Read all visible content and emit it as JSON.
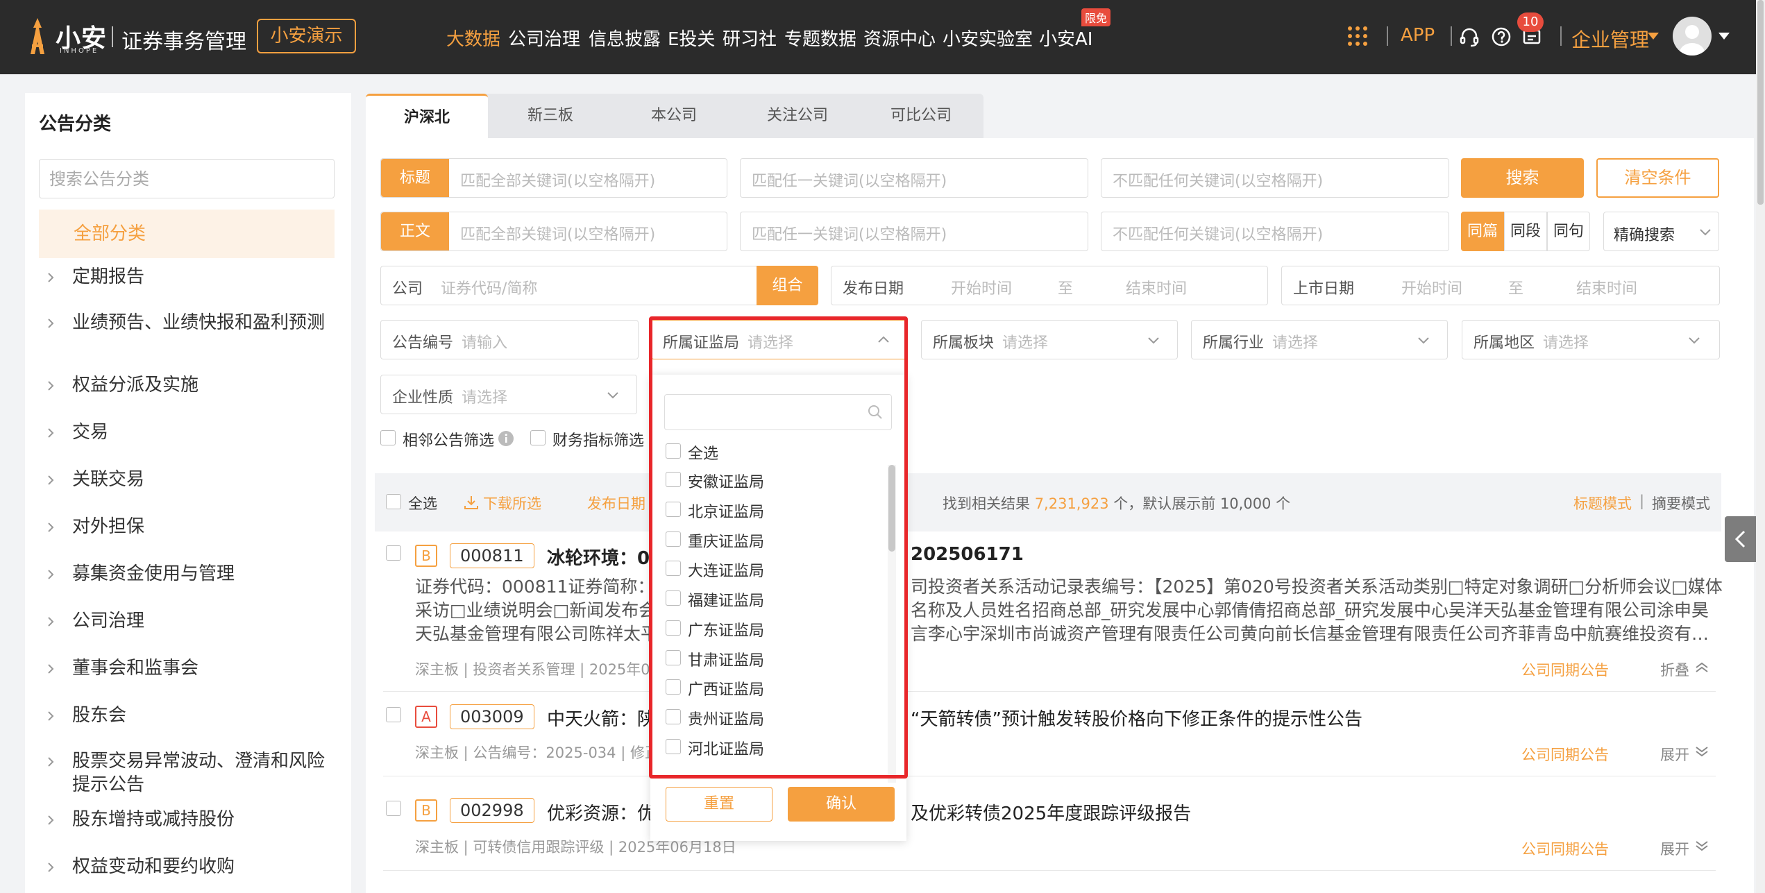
{
  "topbar": {
    "logo_text": "小安",
    "logo_sub": "INHOPE",
    "app_title": "证券事务管理",
    "demo_button": "小安演示",
    "nav": [
      "大数据",
      "公司治理",
      "信息披露",
      "E投关",
      "研习社",
      "专题数据",
      "资源中心",
      "小安实验室",
      "小安AI"
    ],
    "nav_active": "大数据",
    "limited_badge": "限免",
    "app_link": "APP",
    "message_count": "10",
    "enterprise_menu": "企业管理",
    "accent_color": "#f5a040"
  },
  "sidebar": {
    "title": "公告分类",
    "search_placeholder": "搜索公告分类",
    "all_label": "全部分类",
    "items": [
      "定期报告",
      "业绩预告、业绩快报和盈利预测",
      "权益分派及实施",
      "交易",
      "关联交易",
      "对外担保",
      "募集资金使用与管理",
      "公司治理",
      "董事会和监事会",
      "股东会",
      "股票交易异常波动、澄清和风险提示公告",
      "股东增持或减持股份",
      "权益变动和要约收购"
    ]
  },
  "tabs": [
    "沪深北",
    "新三板",
    "本公司",
    "关注公司",
    "可比公司"
  ],
  "filters": {
    "title_label": "标题",
    "body_label": "正文",
    "match_all_ph": "匹配全部关键词(以空格隔开)",
    "match_any_ph": "匹配任一关键词(以空格隔开)",
    "match_none_ph": "不匹配任何关键词(以空格隔开)",
    "search_button": "搜索",
    "clear_button": "清空条件",
    "scope_options": [
      "同篇",
      "同段",
      "同句"
    ],
    "scope_active": "同篇",
    "precision_select": "精确搜索",
    "company_label": "公司",
    "company_ph": "证券代码/简称",
    "combo_button": "组合",
    "publish_date_label": "发布日期",
    "listing_date_label": "上市日期",
    "start_ph": "开始时间",
    "to": "至",
    "end_ph": "结束时间",
    "notice_no_label": "公告编号",
    "notice_no_ph": "请输入",
    "regulator_label": "所属证监局",
    "select_ph": "请选择",
    "sector_label": "所属板块",
    "industry_label": "所属行业",
    "region_label": "所属地区",
    "nature_label": "企业性质",
    "adjacent_filter": "相邻公告筛选",
    "finance_filter": "财务指标筛选"
  },
  "results_bar": {
    "select_all": "全选",
    "download": "下载所选",
    "sort_publish": "发布日期",
    "found_prefix": "找到相关结果",
    "count": "7,231,923",
    "found_suffix": "个，默认展示前 10,000 个",
    "mode_title": "标题模式",
    "mode_sep": "|",
    "mode_summary": "摘要模式"
  },
  "results": [
    {
      "level": "B",
      "code": "000811",
      "title_left": "冰轮环境：00",
      "title_right": "司投资者关系活动记录表编号：【2025】第020号投资者关系活动类别□特定对象调研□分析师会议□媒体",
      "title_right_head": "202506171",
      "body_left_1": "证券代码：000811证券简称：冫",
      "body_right_1": "司投资者关系活动记录表编号：【2025】第020号投资者关系活动类别□特定对象调研□分析师会议□媒体",
      "body_left_2": "采访□业绩说明会□新闻发布会",
      "body_right_2": "名称及人员姓名招商总部_研究发展中心郭倩倩招商总部_研究发展中心吴洋天弘基金管理有限公司涂申昊",
      "body_left_3": "天弘基金管理有限公司陈祥太平",
      "body_right_3": "言李心宇深圳市尚诚资产管理有限责任公司黄向前长信基金管理有限责任公司齐菲青岛中航赛维投资有…",
      "meta": "深主板 | 投资者关系管理 | 2025年06",
      "link": "公司同期公告",
      "toggle": "折叠"
    },
    {
      "level": "A",
      "code": "003009",
      "title_left": "中天火箭：陕",
      "title_right": "“天箭转债”预计触发转股价格向下修正条件的提示性公告",
      "meta": "深主板 | 公告编号：2025-034 | 修正",
      "link": "公司同期公告",
      "toggle": "展开"
    },
    {
      "level": "B",
      "code": "002998",
      "title_left": "优彩资源：优",
      "title_right": "及优彩转债2025年度跟踪评级报告",
      "meta": "深主板 | 可转债信用跟踪评级 | 2025年06月18日",
      "link": "公司同期公告",
      "toggle": "展开"
    }
  ],
  "popup": {
    "options": [
      "全选",
      "安徽证监局",
      "北京证监局",
      "重庆证监局",
      "大连证监局",
      "福建证监局",
      "广东证监局",
      "甘肃证监局",
      "广西证监局",
      "贵州证监局",
      "河北证监局"
    ],
    "reset": "重置",
    "confirm": "确认"
  }
}
